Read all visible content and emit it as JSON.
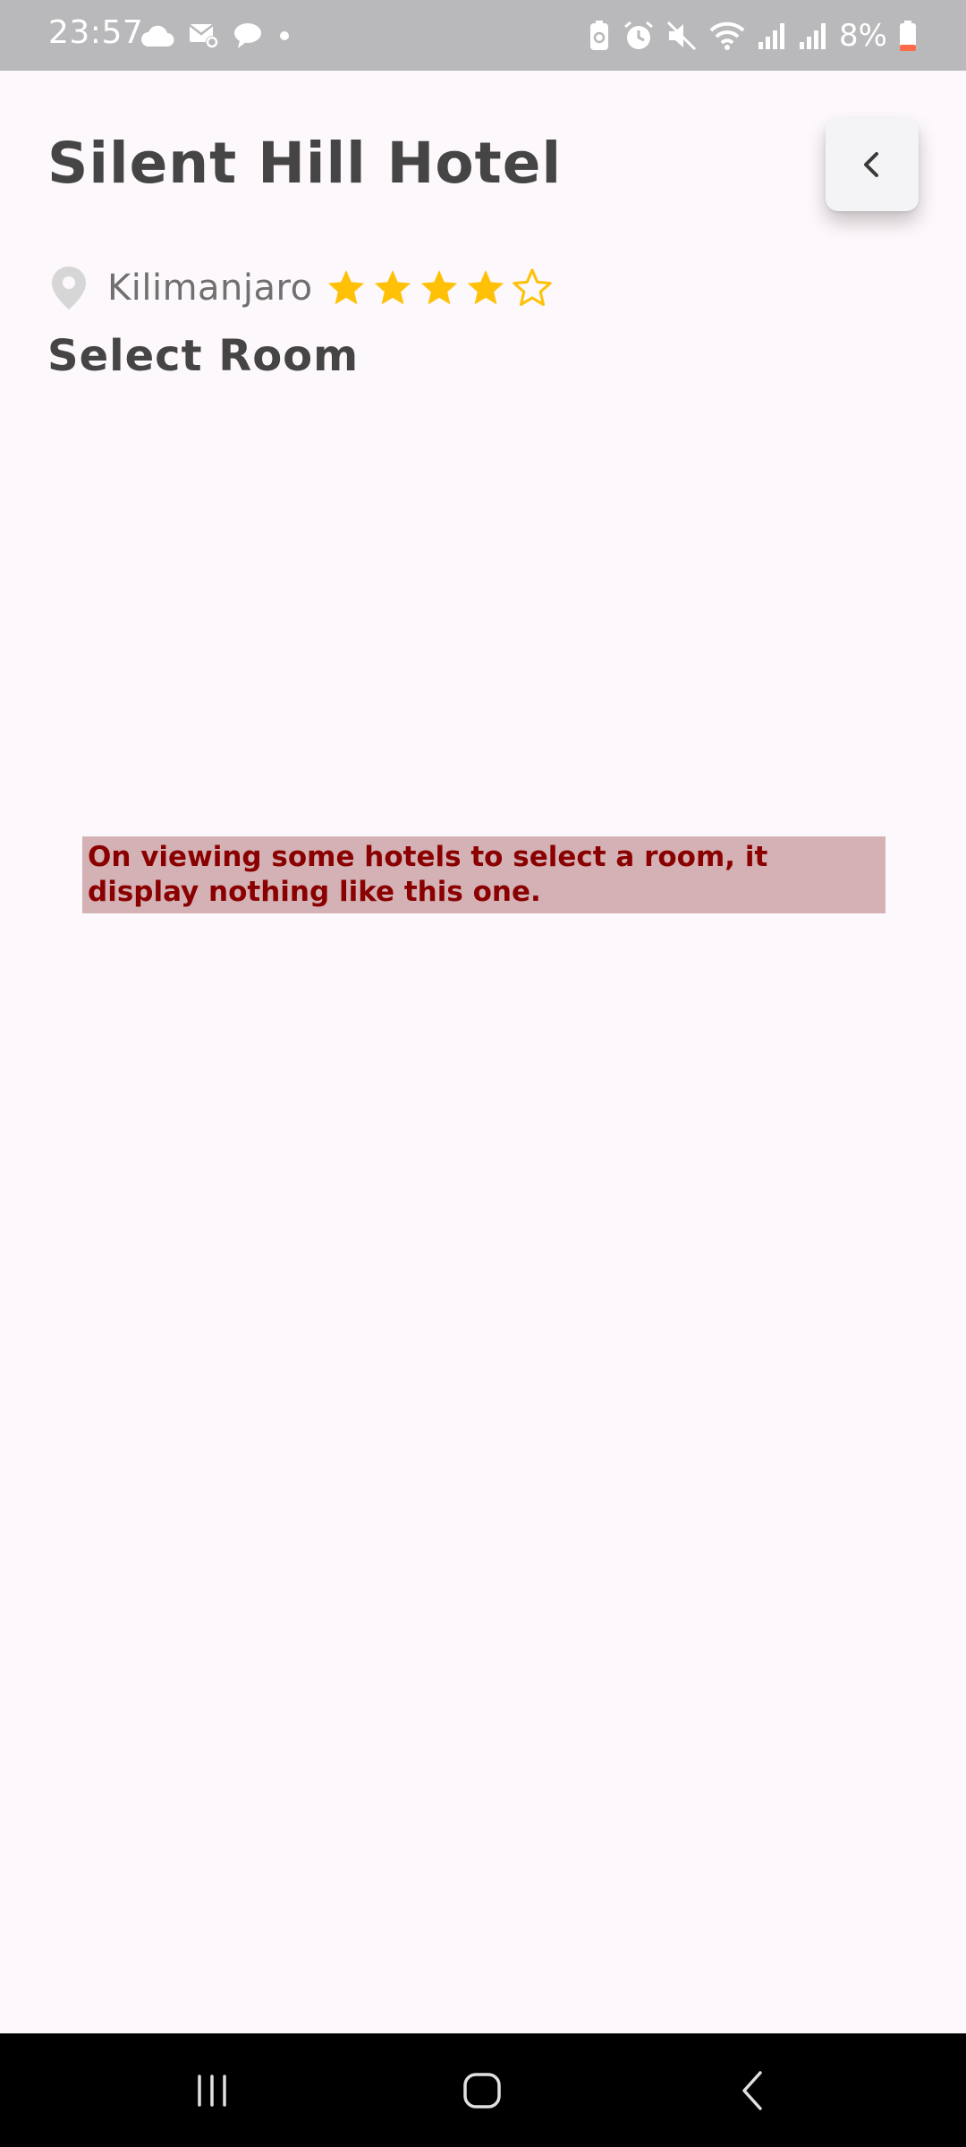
{
  "status_bar": {
    "time": "23:57",
    "battery": "8%",
    "left_icons": [
      "cloud-icon",
      "mail-settings-icon",
      "chat-bubble-icon",
      "dot-icon"
    ],
    "right_icons": [
      "battery-saver-icon",
      "alarm-icon",
      "mute-icon",
      "wifi-icon",
      "signal-icon",
      "signal-icon",
      "battery-icon"
    ],
    "background": "#b9b8ba"
  },
  "hotel": {
    "title": "Silent Hill Hotel",
    "location": "Kilimanjaro",
    "rating": 4,
    "max_rating": 5
  },
  "section": {
    "title": "Select Room"
  },
  "note": {
    "text": "On viewing some hotels to select a room, it display nothing like this one."
  },
  "nav_bar": {
    "buttons": [
      "recent-apps-icon",
      "home-icon",
      "back-icon"
    ]
  },
  "colors": {
    "star": "#ffc107",
    "title_text": "#454545",
    "background": "#fdf8fb",
    "note_background": "#d4b1b4",
    "note_text": "#8a0000"
  }
}
